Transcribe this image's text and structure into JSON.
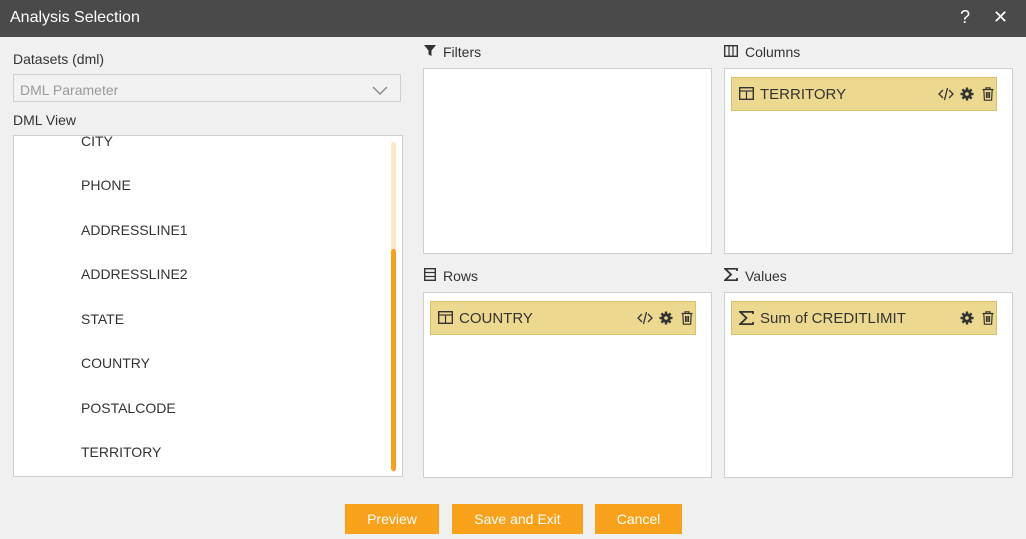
{
  "window": {
    "title": "Analysis Selection",
    "help_glyph": "?",
    "close_glyph": "✕"
  },
  "datasets": {
    "label": "Datasets (dml)",
    "selected": "DML Parameter"
  },
  "dml_view": {
    "label": "DML View",
    "items": [
      "CITY",
      "PHONE",
      "ADDRESSLINE1",
      "ADDRESSLINE2",
      "STATE",
      "COUNTRY",
      "POSTALCODE",
      "TERRITORY"
    ]
  },
  "panels": {
    "filters": {
      "label": "Filters"
    },
    "columns": {
      "label": "Columns",
      "chips": [
        {
          "name": "TERRITORY"
        }
      ]
    },
    "rows": {
      "label": "Rows",
      "chips": [
        {
          "name": "COUNTRY"
        }
      ]
    },
    "values": {
      "label": "Values",
      "chips": [
        {
          "name": "Sum of CREDITLIMIT"
        }
      ]
    }
  },
  "buttons": {
    "preview": "Preview",
    "save_exit": "Save and Exit",
    "cancel": "Cancel"
  },
  "colors": {
    "accent": "#f7a21a",
    "chip_bg": "#ecd98f",
    "titlebar": "#4a4a4a"
  }
}
